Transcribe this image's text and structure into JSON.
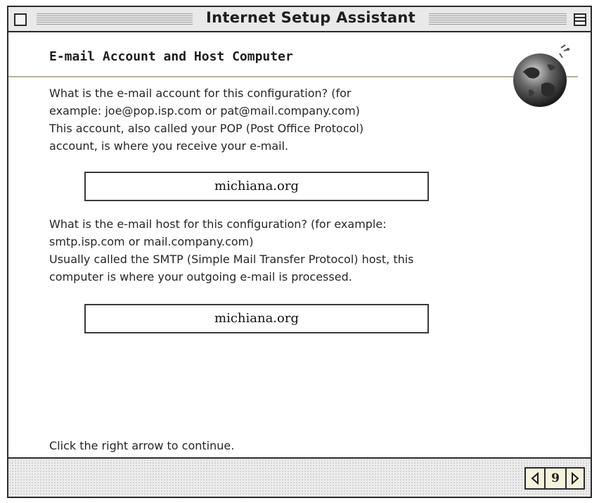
{
  "window": {
    "title": "Internet Setup Assistant"
  },
  "page": {
    "section_title": "E-mail Account and Host Computer",
    "question1_lines": [
      "What is the e-mail account for this configuration? (for",
      "example: joe@pop.isp.com or pat@mail.company.com)",
      "This account, also called your POP (Post Office Protocol)",
      "account, is where you receive your e-mail."
    ],
    "account_field_value": "michiana.org",
    "question2_lines": [
      "What is the e-mail host for this configuration? (for example:",
      "smtp.isp.com or mail.company.com)",
      "Usually called the SMTP (Simple Mail Transfer Protocol) host, this",
      "computer is where your outgoing e-mail is processed."
    ],
    "host_field_value": "michiana.org",
    "footer_instruction": "Click the right arrow to continue."
  },
  "navigation": {
    "page_number": "9",
    "prev_icon": "left-arrow-icon",
    "next_icon": "right-arrow-icon"
  },
  "icons": {
    "close_box": "close-box-icon",
    "collapse_box": "collapse-box-icon",
    "globe": "globe-icon"
  }
}
